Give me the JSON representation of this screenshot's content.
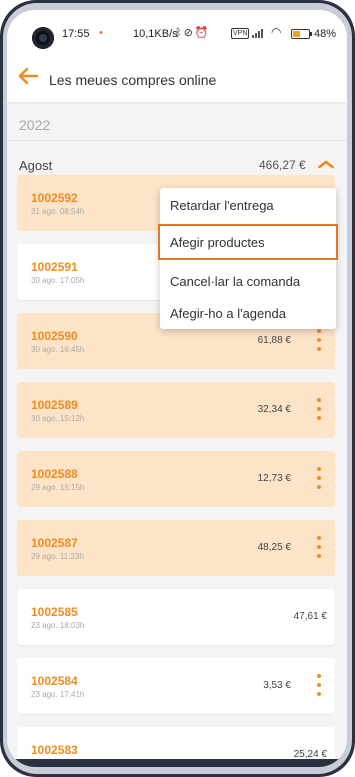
{
  "status_bar": {
    "time": "17:55",
    "dot": "•",
    "network_speed": "10,1KB/s",
    "vpn_label": "VPN",
    "battery_percent": "48",
    "battery_level": 0.48,
    "icons": [
      "bluetooth-icon",
      "mute-icon",
      "alarm-icon",
      "vpn-icon",
      "signal-icon",
      "wifi-icon",
      "battery-icon"
    ]
  },
  "header": {
    "title": "Les meues compres online",
    "back_icon": "arrow-left-icon"
  },
  "year": "2022",
  "month": {
    "name": "Agost",
    "total": "466,27 €",
    "toggle_icon": "chevron-up-icon"
  },
  "orders": [
    {
      "number": "1002592",
      "date": "31 ago. 08:54h",
      "amount": "",
      "highlight": true,
      "has_menu": true
    },
    {
      "number": "1002591",
      "date": "30 ago. 17:05h",
      "amount": "",
      "highlight": false,
      "has_menu": true
    },
    {
      "number": "1002590",
      "date": "30 ago. 16:45h",
      "amount": "61,88 €",
      "highlight": true,
      "has_menu": true
    },
    {
      "number": "1002589",
      "date": "30 ago. 15:12h",
      "amount": "32,34 €",
      "highlight": true,
      "has_menu": true
    },
    {
      "number": "1002588",
      "date": "29 ago. 15:15h",
      "amount": "12,73 €",
      "highlight": true,
      "has_menu": true
    },
    {
      "number": "1002587",
      "date": "29 ago. 11:23h",
      "amount": "48,25 €",
      "highlight": true,
      "has_menu": true
    },
    {
      "number": "1002585",
      "date": "23 ago. 18:03h",
      "amount": "47,61 €",
      "highlight": false,
      "has_menu": false
    },
    {
      "number": "1002584",
      "date": "23 ago. 17:41h",
      "amount": "3,53 €",
      "highlight": false,
      "has_menu": true
    },
    {
      "number": "1002583",
      "date": "",
      "amount": "25,24 €",
      "highlight": false,
      "has_menu": false
    }
  ],
  "context_menu": {
    "items": [
      {
        "label": "Retardar l'entrega"
      },
      {
        "label": "Afegir productes",
        "selected": true
      },
      {
        "label": "Cancel·lar la comanda"
      },
      {
        "label": "Afegir-ho a l'agenda"
      }
    ]
  },
  "colors": {
    "accent": "#f28c1e",
    "highlight_bg": "#fde3c8",
    "selection_border": "#e2772a"
  }
}
